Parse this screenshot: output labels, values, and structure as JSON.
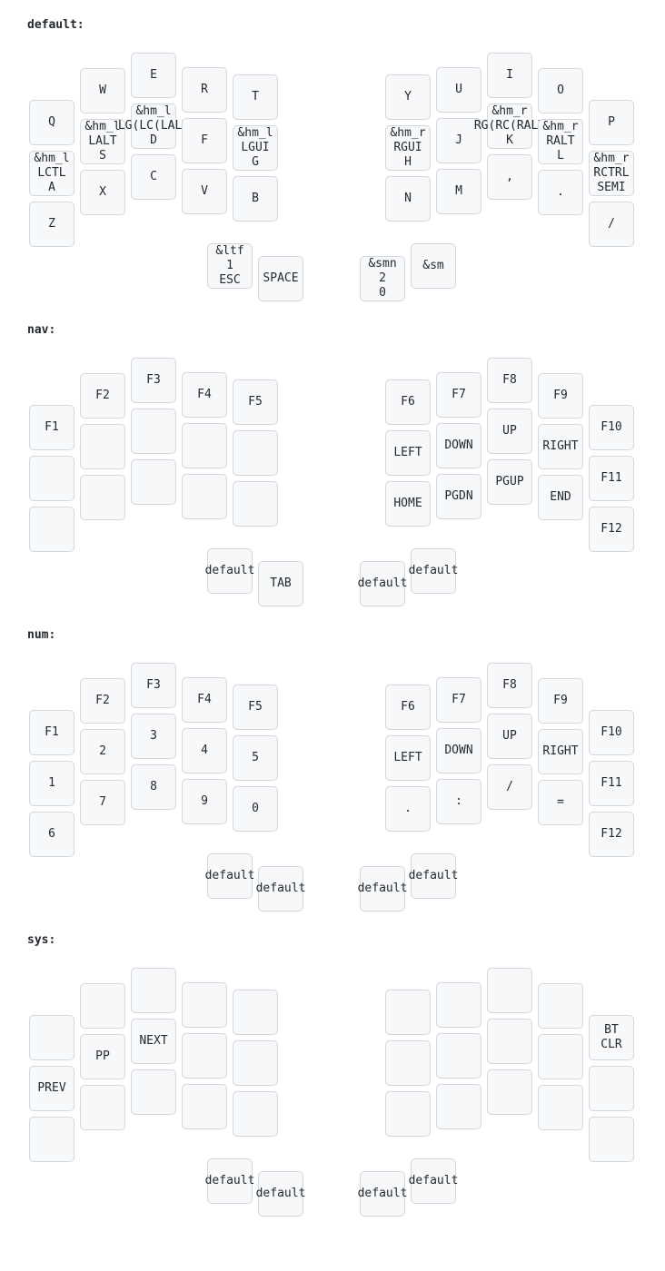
{
  "layers": [
    {
      "name": "default:",
      "keys": [
        "Q",
        "W",
        "E",
        "R",
        "T",
        "Y",
        "U",
        "I",
        "O",
        "P",
        "&hm_l\nLCTL\nA",
        "&hm_l\nLALT\nS",
        "&hm_l\nLG(LC(LALT\nD",
        "F",
        "&hm_l\nLGUI\nG",
        "&hm_r\nRGUI\nH",
        "J",
        "&hm_r\nRG(RC(RALT\nK",
        "&hm_r\nRALT\nL",
        "&hm_r\nRCTRL\nSEMI",
        "Z",
        "X",
        "C",
        "V",
        "B",
        "N",
        "M",
        ",",
        ".",
        "/",
        "&ltf\n1\nESC",
        "SPACE",
        "&smn\n2\n0",
        "&sm"
      ]
    },
    {
      "name": "nav:",
      "keys": [
        "F1",
        "F2",
        "F3",
        "F4",
        "F5",
        "F6",
        "F7",
        "F8",
        "F9",
        "F10",
        "",
        "",
        "",
        "",
        "",
        "LEFT",
        "DOWN",
        "UP",
        "RIGHT",
        "F11",
        "",
        "",
        "",
        "",
        "",
        "HOME",
        "PGDN",
        "PGUP",
        "END",
        "F12",
        "default",
        "TAB",
        "default",
        "default"
      ]
    },
    {
      "name": "num:",
      "keys": [
        "F1",
        "F2",
        "F3",
        "F4",
        "F5",
        "F6",
        "F7",
        "F8",
        "F9",
        "F10",
        "1",
        "2",
        "3",
        "4",
        "5",
        "LEFT",
        "DOWN",
        "UP",
        "RIGHT",
        "F11",
        "6",
        "7",
        "8",
        "9",
        "0",
        ".",
        ":",
        "/",
        "=",
        "F12",
        "default",
        "default",
        "default",
        "default"
      ]
    },
    {
      "name": "sys:",
      "keys": [
        "",
        "",
        "",
        "",
        "",
        "",
        "",
        "",
        "",
        "BT\nCLR",
        "PREV",
        "PP",
        "NEXT",
        "",
        "",
        "",
        "",
        "",
        "",
        "",
        "",
        "",
        "",
        "",
        "",
        "",
        "",
        "",
        "",
        "",
        "default",
        "default",
        "default",
        "default"
      ]
    }
  ]
}
